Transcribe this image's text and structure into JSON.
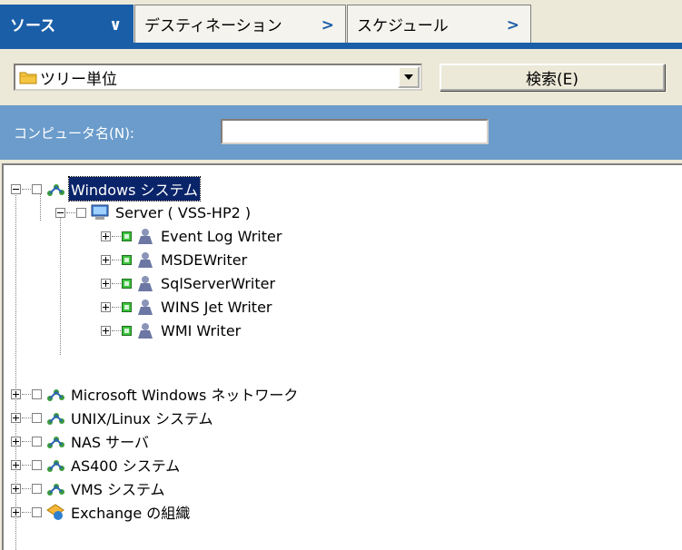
{
  "tabs": [
    {
      "label": "ソース",
      "arrow": "∨"
    },
    {
      "label": "デスティネーション",
      "arrow": ">"
    },
    {
      "label": "スケジュール",
      "arrow": ">"
    }
  ],
  "view_combo": {
    "value": "ツリー単位"
  },
  "search_button": {
    "label": "検索(E)"
  },
  "computer_name": {
    "label": "コンピュータ名(N):",
    "value": ""
  },
  "tree": {
    "windows": {
      "label": "Windows システム"
    },
    "server": {
      "label": "Server ( VSS-HP2 )"
    },
    "writers": [
      {
        "label": "Event Log Writer"
      },
      {
        "label": "MSDEWriter"
      },
      {
        "label": "SqlServerWriter"
      },
      {
        "label": "WINS Jet Writer"
      },
      {
        "label": "WMI Writer"
      }
    ],
    "others": [
      {
        "label": "Microsoft Windows ネットワーク"
      },
      {
        "label": "UNIX/Linux システム"
      },
      {
        "label": "NAS サーバ"
      },
      {
        "label": "AS400 システム"
      },
      {
        "label": "VMS システム"
      },
      {
        "label": "Exchange の組織"
      }
    ]
  },
  "colors": {
    "tab_active": "#1b5ea8",
    "name_bar": "#6b9ccb",
    "selection": "#0a246a",
    "check_green": "#3cc23c"
  }
}
